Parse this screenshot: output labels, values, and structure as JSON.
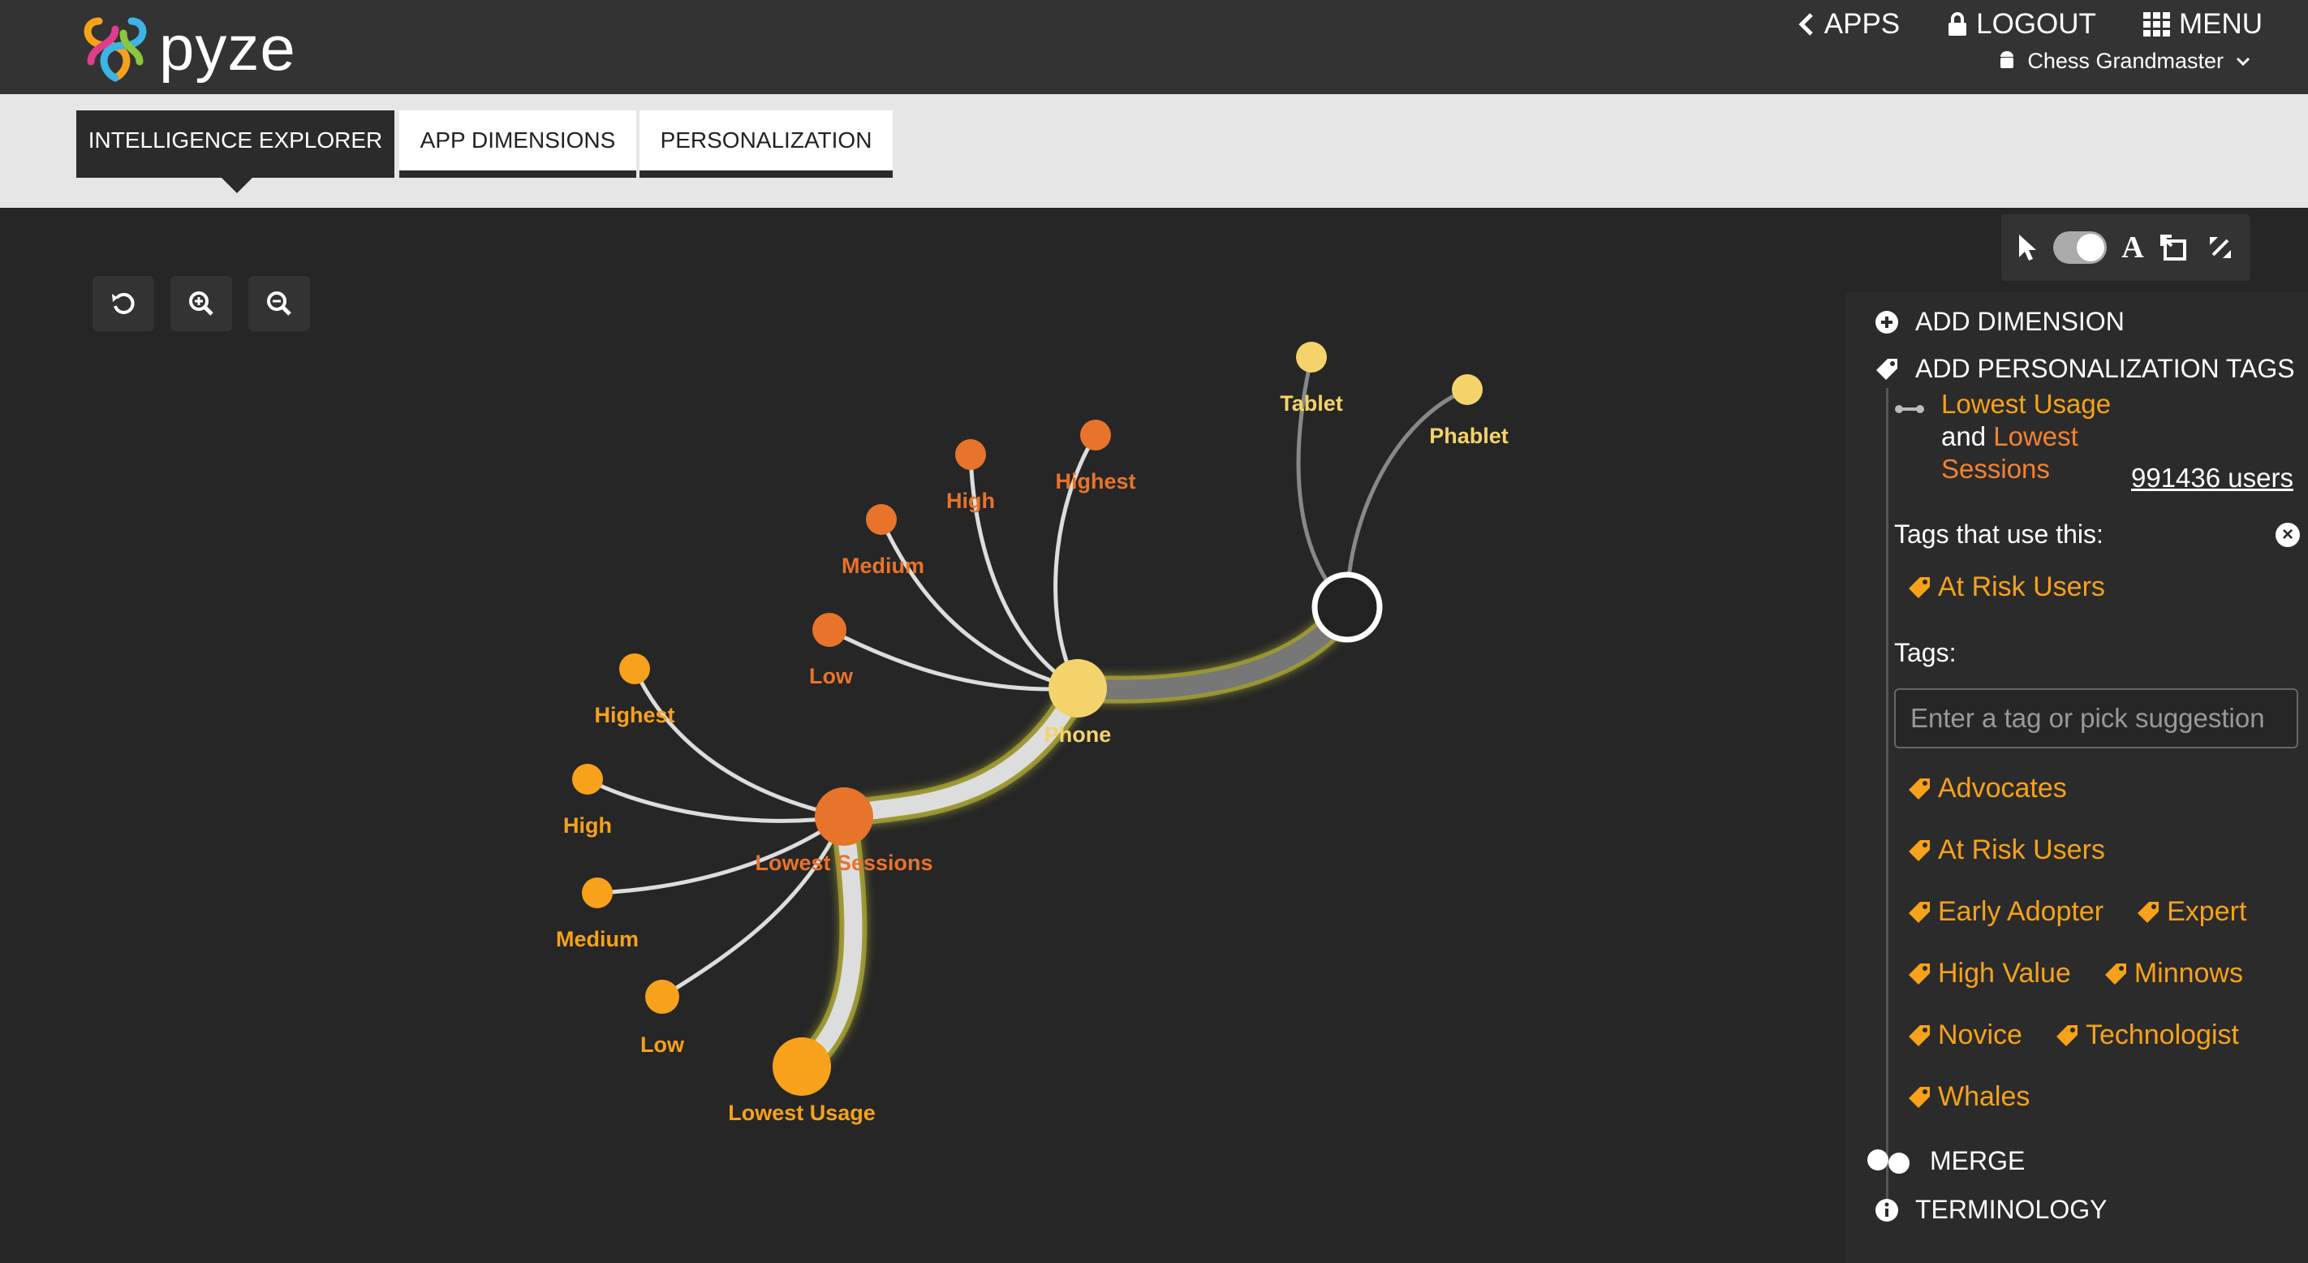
{
  "brand": {
    "name": "pyze"
  },
  "topnav": {
    "apps": "APPS",
    "logout": "LOGOUT",
    "menu": "MENU",
    "app_name": "Chess Grandmaster"
  },
  "tabs": [
    "INTELLIGENCE EXPLORER",
    "APP DIMENSIONS",
    "PERSONALIZATION"
  ],
  "graph": {
    "phone": "Phone",
    "tablet": "Tablet",
    "phablet": "Phablet",
    "lowest_sessions": "Lowest Sessions",
    "lowest_usage": "Lowest Usage",
    "session_levels": {
      "low": "Low",
      "medium": "Medium",
      "high": "High",
      "highest": "Highest"
    },
    "usage_levels": {
      "highest": "Highest",
      "high": "High",
      "medium": "Medium",
      "low": "Low"
    }
  },
  "panel": {
    "add_dimension": "ADD DIMENSION",
    "add_tags": "ADD PERSONALIZATION TAGS",
    "filter": {
      "part1": "Lowest Usage",
      "and": "and",
      "part2": "Lowest Sessions"
    },
    "users": "991436 users",
    "tags_use_label": "Tags that use this:",
    "used_tag": "At Risk Users",
    "tags_label": "Tags:",
    "tag_placeholder": "Enter a tag or pick suggestion",
    "tags": [
      "Advocates",
      "At Risk Users",
      "Early Adopter",
      "Expert",
      "High Value",
      "Minnows",
      "Novice",
      "Technologist",
      "Whales"
    ],
    "merge": "MERGE",
    "terminology": "TERMINOLOGY"
  },
  "colors": {
    "accent": "#f7a21a",
    "orange": "#e8732a",
    "yellow": "#f5d36b",
    "bg": "#262626"
  }
}
